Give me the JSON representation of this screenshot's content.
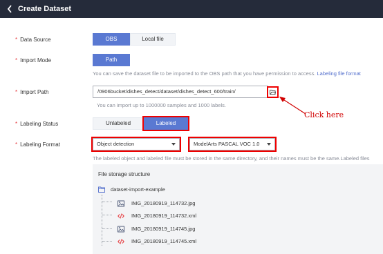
{
  "header": {
    "title": "Create Dataset"
  },
  "data_source": {
    "label": "Data Source",
    "options": [
      "OBS",
      "Local file"
    ],
    "selected": "OBS"
  },
  "import_mode": {
    "label": "Import Mode",
    "options": [
      "Path"
    ],
    "selected": "Path",
    "hint": "You can save the dataset file to be imported to the OBS path that you have permission to access.",
    "hint_link": "Labeling file format"
  },
  "import_path": {
    "label": "Import Path",
    "value": "/0906bucket/dishes_detect/dataset/dishes_detect_600/train/",
    "hint": "You can import up to 1000000 samples and 1000 labels.",
    "browse_icon": "folder-open-icon"
  },
  "annotation": {
    "text": "Click here"
  },
  "labeling_status": {
    "label": "Labeling Status",
    "options": [
      "Unlabeled",
      "Labeled"
    ],
    "selected": "Labeled"
  },
  "labeling_format": {
    "label": "Labeling Format",
    "type_value": "Object detection",
    "format_value": "ModelArts PASCAL VOC 1.0",
    "hint": "The labeled object and labeled file must be stored in the same directory, and their names must be the same.Labeled files"
  },
  "file_structure": {
    "title": "File storage structure",
    "root": "dataset-import-example",
    "files": [
      {
        "name": "IMG_20180919_114732.jpg",
        "icon": "image-icon"
      },
      {
        "name": "IMG_20180919_114732.xml",
        "icon": "code-icon"
      },
      {
        "name": "IMG_20180919_114745.jpg",
        "icon": "image-icon"
      },
      {
        "name": "IMG_20180919_114745.xml",
        "icon": "code-icon"
      }
    ]
  },
  "colors": {
    "header_bg": "#252b3a",
    "accent": "#5a79d2",
    "required": "#e5373b",
    "highlight": "#e00000",
    "link": "#526ecc"
  }
}
